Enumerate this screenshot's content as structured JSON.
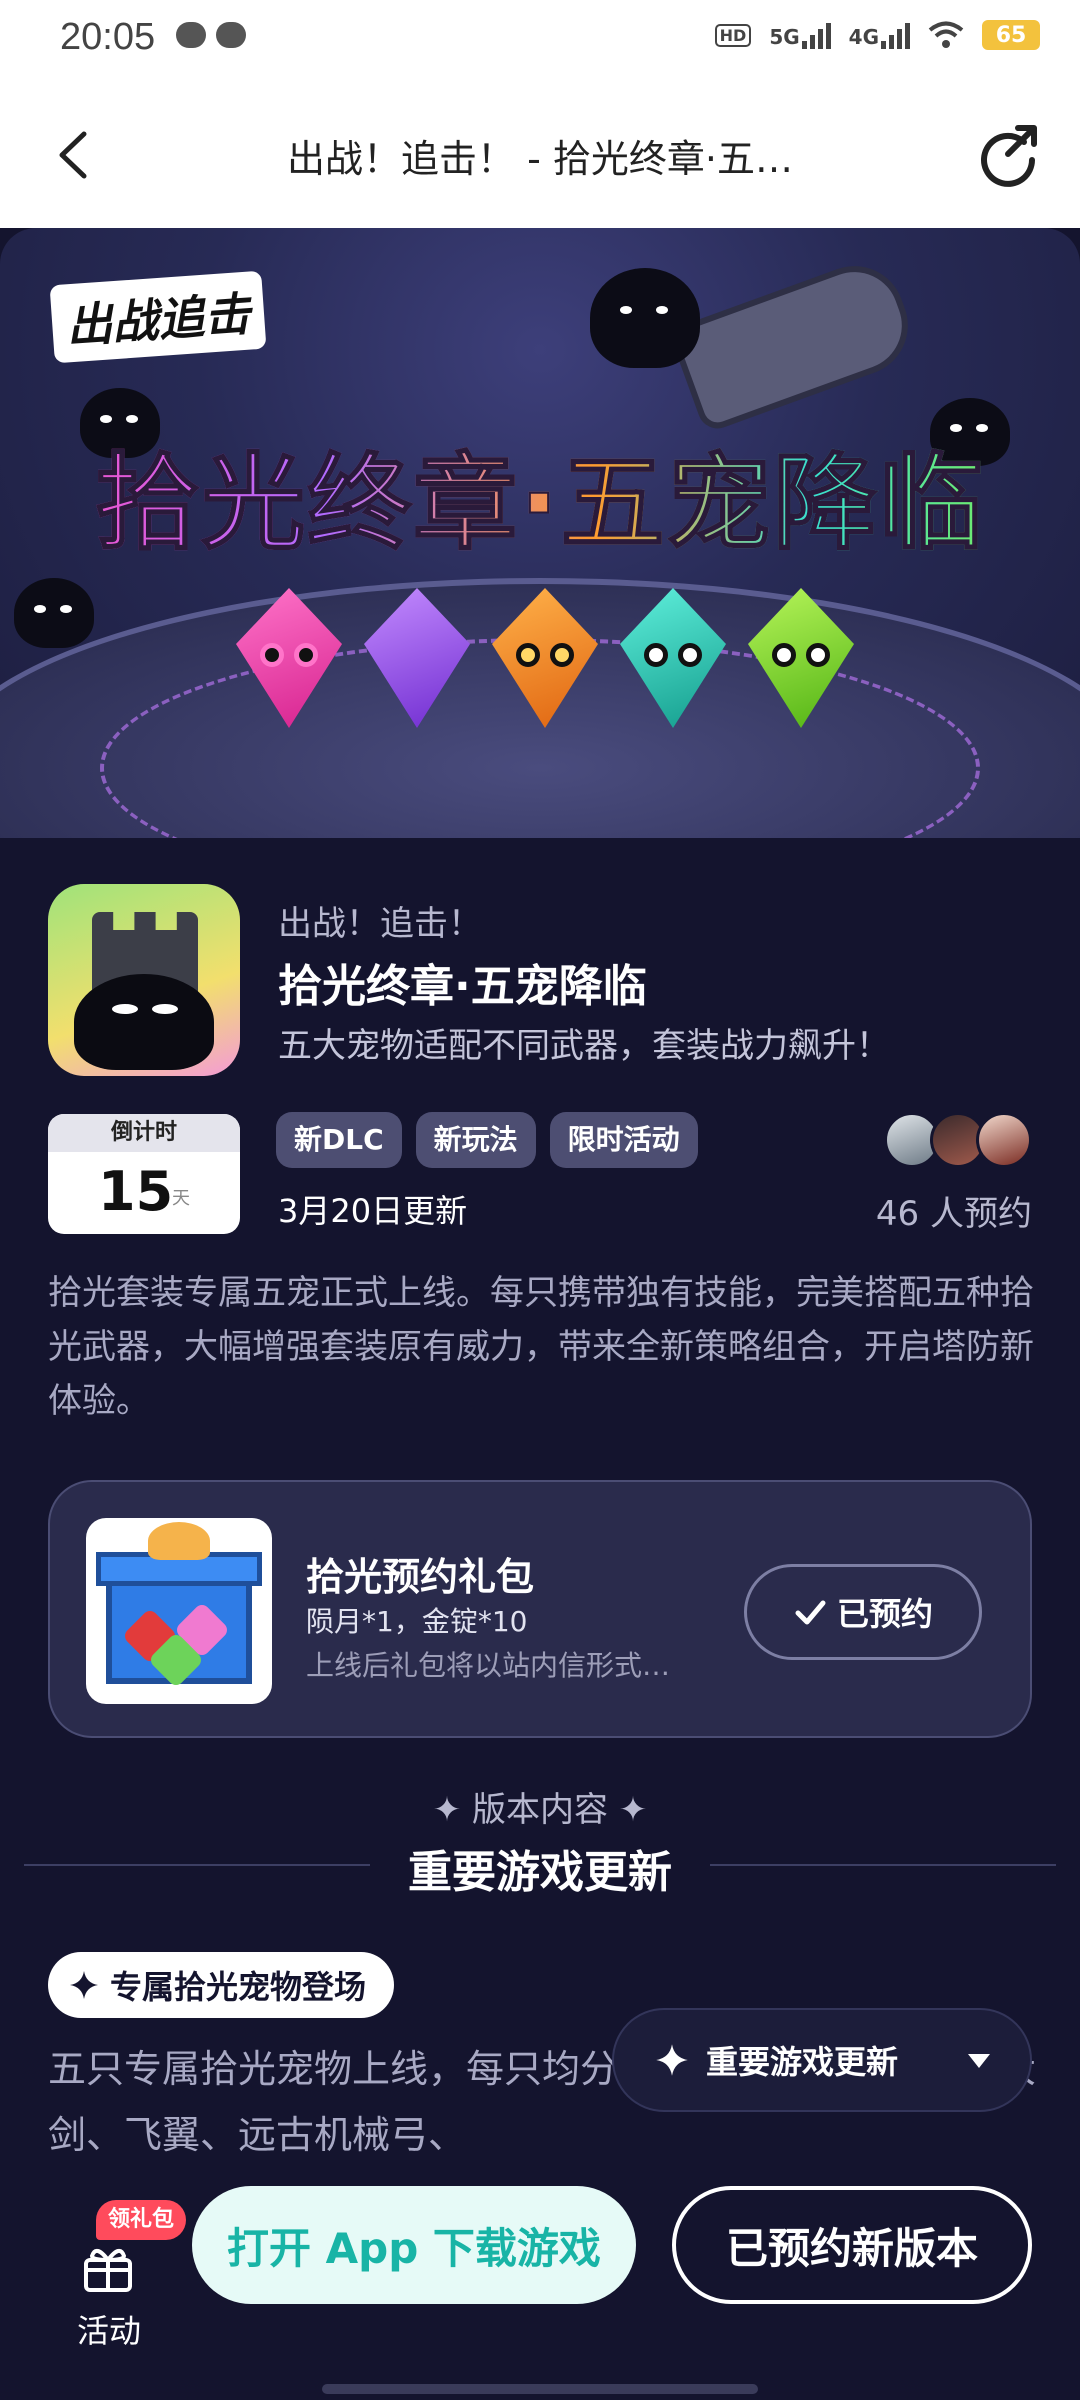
{
  "status_bar": {
    "time": "20:05",
    "network_hd": "HD",
    "network_5g": "5G",
    "network_4g": "4G",
    "battery": "65"
  },
  "nav": {
    "title": "出战！追击！ - 拾光终章·五…"
  },
  "banner": {
    "logo_text": "出战追击",
    "title_text": "拾光终章·五宠降临"
  },
  "game": {
    "subname": "出战！追击！",
    "title": "拾光终章·五宠降临",
    "description": "五大宠物适配不同武器，套装战力飙升！"
  },
  "countdown": {
    "label": "倒计时",
    "days": "15",
    "unit": "天"
  },
  "tags": [
    "新DLC",
    "新玩法",
    "限时活动"
  ],
  "update_date": "3月20日更新",
  "reservation_count": "46 人预约",
  "intro": "拾光套装专属五宠正式上线。每只携带独有技能，完美搭配五种拾光武器，大幅增强套装原有威力，带来全新策略组合，开启塔防新体验。",
  "gift": {
    "title": "拾光预约礼包",
    "items": "陨月*1，金锭*10",
    "note": "上线后礼包将以站内信形式…",
    "button": "已预约"
  },
  "section": {
    "label": "✦ 版本内容 ✦",
    "title": "重要游戏更新"
  },
  "feature": {
    "pill": "专属拾光宠物登场",
    "text": "五只专属拾光宠物上线，每只均分别适配上古钩斧、玲珑大剑、飞翼、远古机械弓、"
  },
  "dropdown": {
    "label": "重要游戏更新"
  },
  "bottom_bar": {
    "activity_badge": "领礼包",
    "activity_label": "活动",
    "open_button": "打开 App 下载游戏",
    "reserve_button": "已预约新版本"
  },
  "colors": {
    "background": "#14142e",
    "accent_teal": "#18b4a6",
    "badge_red": "#ff4b5c"
  }
}
